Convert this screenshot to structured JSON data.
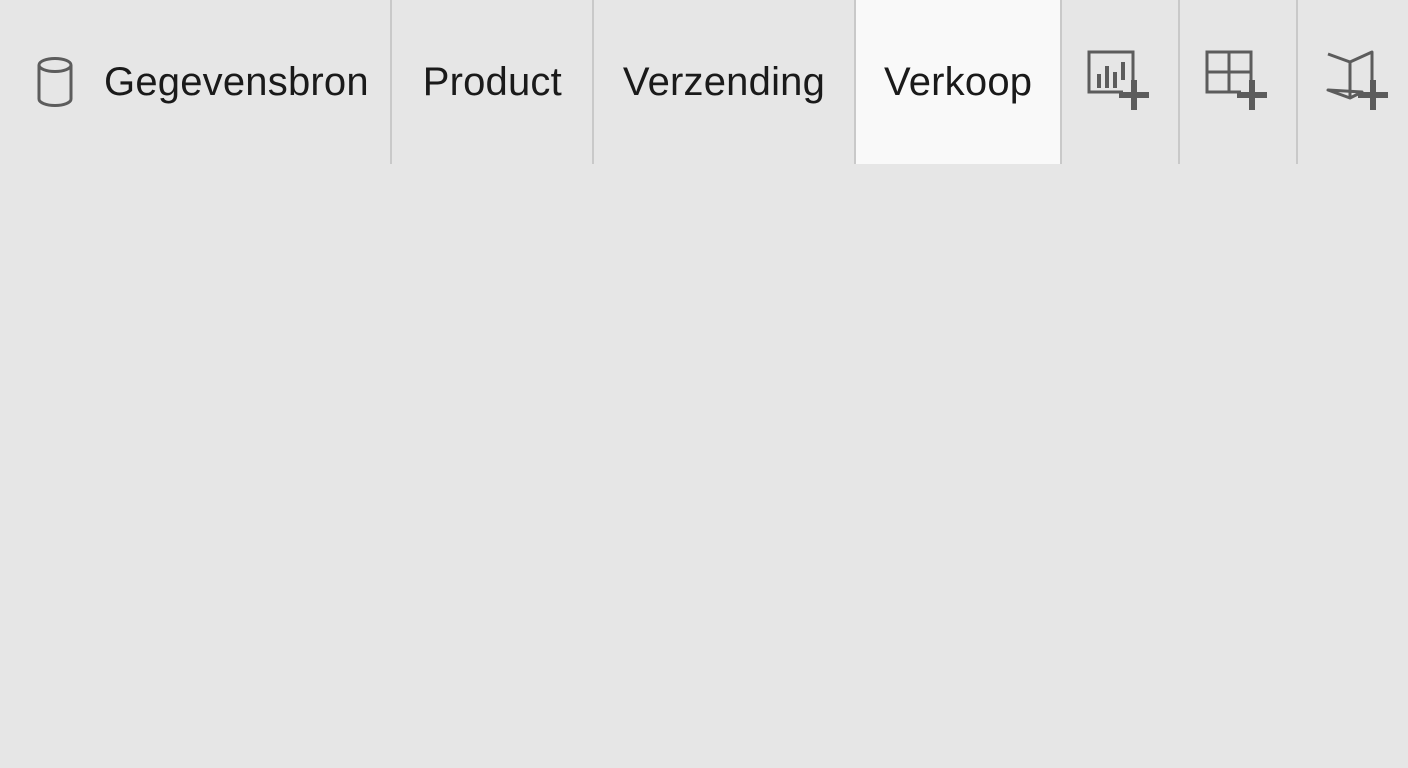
{
  "tabs": {
    "datasource": {
      "label": "Gegevensbron",
      "icon": "database-icon"
    },
    "items": [
      {
        "label": "Product",
        "active": false
      },
      {
        "label": "Verzending",
        "active": false
      },
      {
        "label": "Verkoop",
        "active": true
      }
    ]
  },
  "actions": [
    {
      "icon": "new-worksheet-icon"
    },
    {
      "icon": "new-dashboard-icon"
    },
    {
      "icon": "new-story-icon"
    }
  ],
  "colors": {
    "background": "#e6e6e6",
    "active_tab": "#f9f9f9",
    "divider": "#c9c9c9",
    "icon": "#5c5c5c",
    "text": "#1a1a1a"
  }
}
